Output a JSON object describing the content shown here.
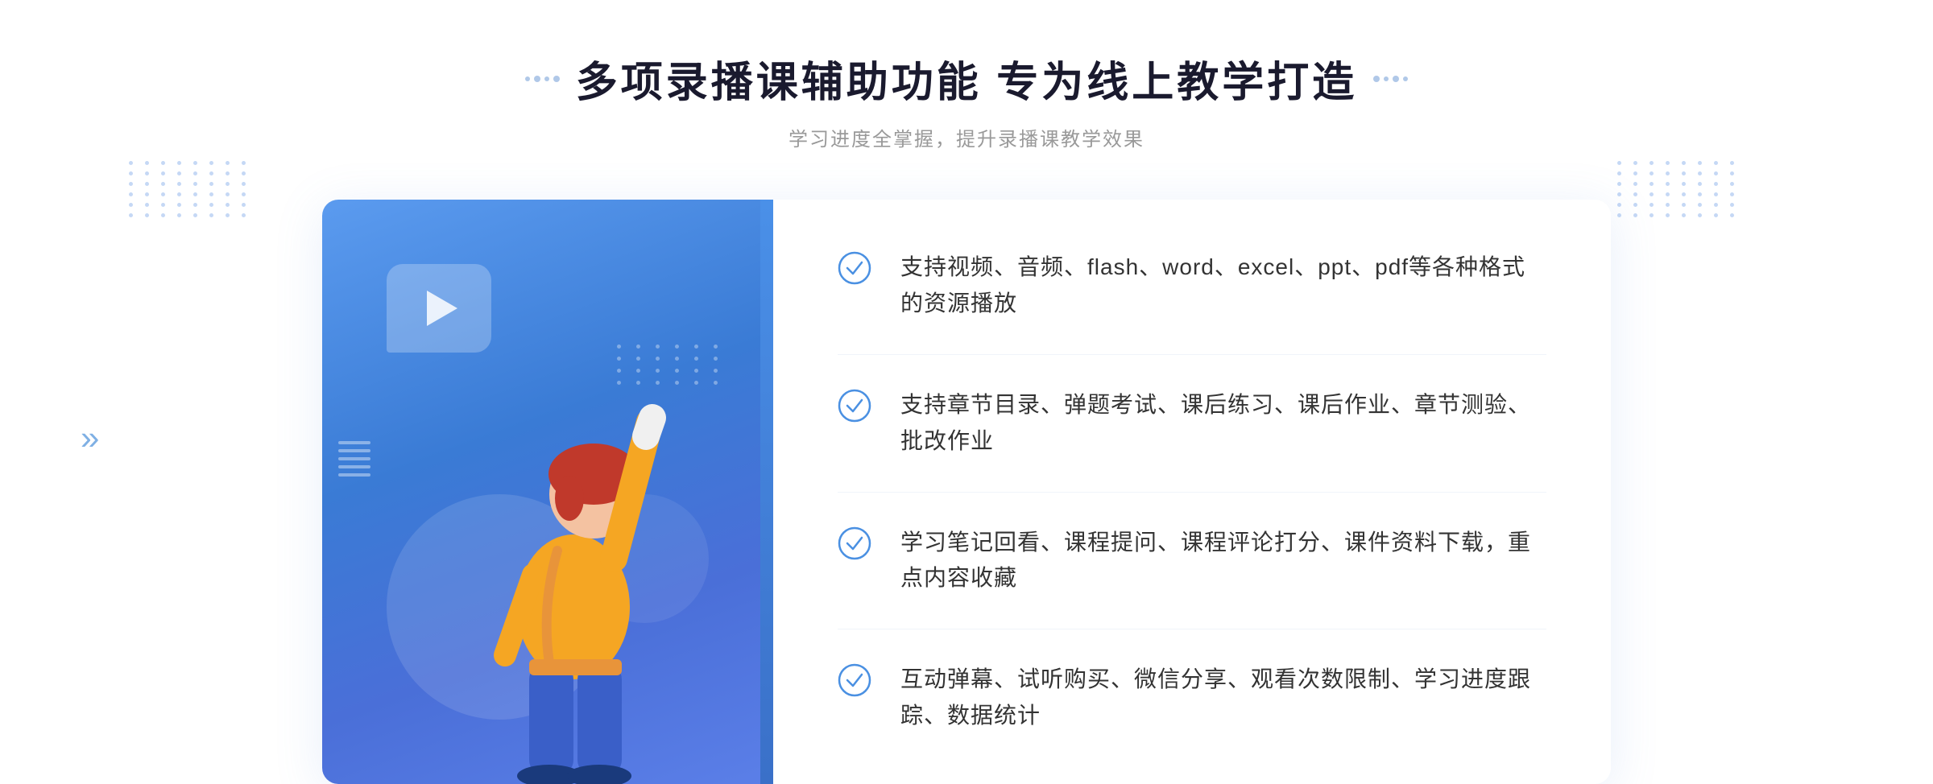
{
  "header": {
    "title": "多项录播课辅助功能 专为线上教学打造",
    "subtitle": "学习进度全掌握，提升录播课教学效果"
  },
  "features": [
    {
      "id": 1,
      "text": "支持视频、音频、flash、word、excel、ppt、pdf等各种格式的资源播放"
    },
    {
      "id": 2,
      "text": "支持章节目录、弹题考试、课后练习、课后作业、章节测验、批改作业"
    },
    {
      "id": 3,
      "text": "学习笔记回看、课程提问、课程评论打分、课件资料下载，重点内容收藏"
    },
    {
      "id": 4,
      "text": "互动弹幕、试听购买、微信分享、观看次数限制、学习进度跟踪、数据统计"
    }
  ],
  "decoration": {
    "chevron_left": "»",
    "dots_count": 48
  }
}
